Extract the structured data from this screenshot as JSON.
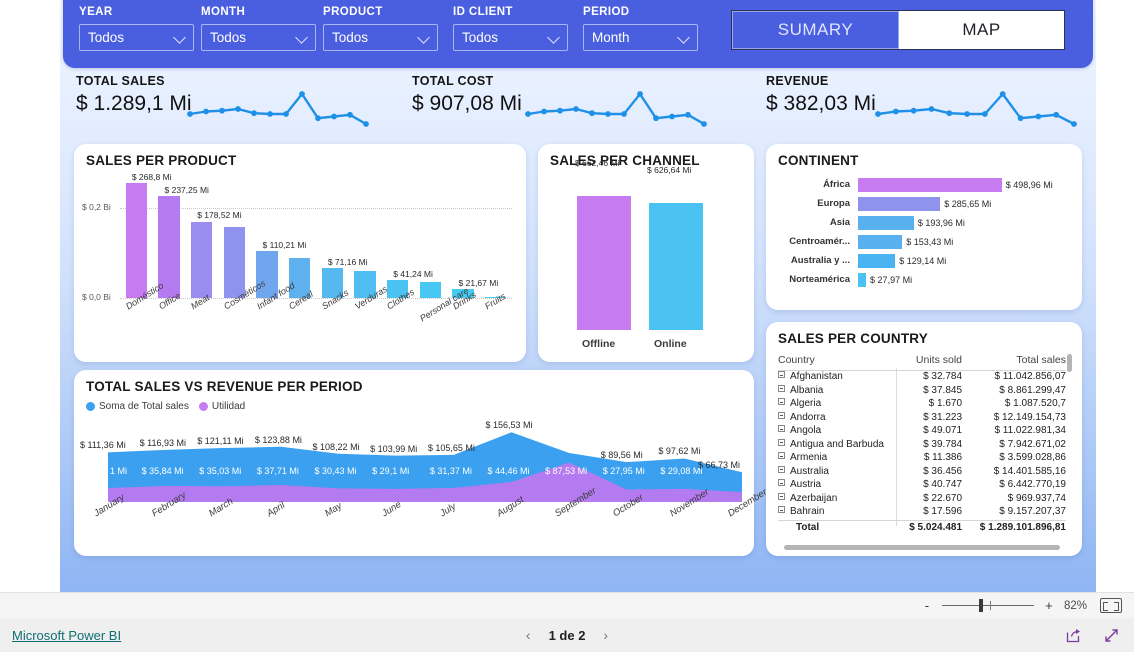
{
  "header": {
    "slicers": [
      {
        "label": "YEAR",
        "value": "Todos"
      },
      {
        "label": "MONTH",
        "value": "Todos"
      },
      {
        "label": "PRODUCT",
        "value": "Todos"
      },
      {
        "label": "ID CLIENT",
        "value": "Todos"
      },
      {
        "label": "PERIOD",
        "value": "Month"
      }
    ],
    "nav": {
      "active": "SUMARY",
      "inactive": "MAP"
    },
    "bg_color": "#4a5fe0"
  },
  "kpis": [
    {
      "title": "TOTAL SALES",
      "value": "$ 1.289,1 Mi"
    },
    {
      "title": "TOTAL COST",
      "value": "$ 907,08 Mi"
    },
    {
      "title": "REVENUE",
      "value": "$ 382,03 Mi"
    }
  ],
  "sparkline": {
    "color": "#1e90e8",
    "points": [
      34,
      40,
      42,
      46,
      36,
      34,
      34,
      82,
      24,
      28,
      32,
      10
    ]
  },
  "chart_data": [
    {
      "id": "sales_per_product",
      "type": "bar",
      "title": "SALES PER PRODUCT",
      "categories": [
        "Doméstico",
        "Office",
        "Meat",
        "Cosméticos",
        "Infant food",
        "Cereal",
        "Snacks",
        "Verduras",
        "Clothes",
        "Personal care",
        "Drinks",
        "Fruits"
      ],
      "values": [
        268.8,
        237.25,
        178.52,
        166.0,
        110.21,
        93.0,
        71.16,
        62.0,
        41.24,
        38.0,
        21.67,
        1.2
      ],
      "labels": [
        "$ 268,8 Mi",
        "$ 237,25 Mi",
        "$ 178,52 Mi",
        "",
        "$ 110,21 Mi",
        "",
        "$ 71,16 Mi",
        "",
        "$ 41,24 Mi",
        "",
        "$ 21,67 Mi",
        ""
      ],
      "colors": [
        "#c77bf0",
        "#b47bf0",
        "#9b8cf0",
        "#8f93ee",
        "#6fa6ee",
        "#5fb0ef",
        "#56b8f0",
        "#4fbdf1",
        "#4ac3f2",
        "#47c7f3",
        "#45cbf4",
        "#44cef5"
      ],
      "ylabel": "",
      "xlabel": "",
      "yticks": [
        "$ 0,2 Bi",
        "$ 0,0 Bi"
      ],
      "ylim": [
        0,
        280
      ],
      "grid": true
    },
    {
      "id": "sales_per_channel",
      "type": "bar",
      "title": "SALES PER CHANNEL",
      "categories": [
        "Offline",
        "Online"
      ],
      "values": [
        662.46,
        626.64
      ],
      "labels": [
        "$ 662,46 Mi",
        "$ 626,64 Mi"
      ],
      "colors": [
        "#c77bf0",
        "#4ac3f2"
      ],
      "ylim": [
        0,
        700
      ],
      "grid": false
    },
    {
      "id": "continent",
      "type": "bar",
      "title": "CONTINENT",
      "orientation": "horizontal",
      "categories": [
        "África",
        "Europa",
        "Asia",
        "Centroamér...",
        "Australia y ...",
        "Norteamérica"
      ],
      "values": [
        498.96,
        285.65,
        193.96,
        153.43,
        129.14,
        27.97
      ],
      "labels": [
        "$ 498,96 Mi",
        "$ 285,65 Mi",
        "$ 193,96 Mi",
        "$ 153,43 Mi",
        "$ 129,14 Mi",
        "$ 27,97 Mi"
      ],
      "colors": [
        "#c77bf0",
        "#8f93ee",
        "#58b0ef",
        "#58b0ef",
        "#4ab4f2",
        "#4ac3f2"
      ],
      "xlim": [
        0,
        500
      ],
      "grid": false
    },
    {
      "id": "total_sales_vs_revenue_per_period",
      "type": "area",
      "title": "TOTAL SALES VS REVENUE PER PERIOD",
      "categories": [
        "January",
        "February",
        "March",
        "April",
        "May",
        "June",
        "July",
        "August",
        "September",
        "October",
        "November",
        "December"
      ],
      "series": [
        {
          "name": "Soma de Total sales",
          "color": "#3aa0ef",
          "values": [
            111.36,
            116.93,
            121.11,
            123.88,
            108.22,
            103.99,
            105.65,
            156.53,
            110.0,
            89.56,
            97.62,
            66.73
          ],
          "labels": [
            "$ 111,36 Mi",
            "$ 116,93 Mi",
            "$ 121,11 Mi",
            "$ 123,88 Mi",
            "$ 108,22 Mi",
            "$ 103,99 Mi",
            "$ 105,65 Mi",
            "$ 156,53 Mi",
            "",
            "$ 89,56 Mi",
            "$ 97,62 Mi",
            "$ 66,73 Mi"
          ]
        },
        {
          "name": "Utilidad",
          "color": "#b47bf0",
          "values": [
            31.1,
            35.84,
            35.03,
            37.71,
            30.43,
            29.1,
            31.37,
            44.46,
            87.53,
            27.95,
            29.08,
            22.0
          ],
          "labels": [
            "1 Mi",
            "$ 35,84 Mi",
            "$ 35,03 Mi",
            "$ 37,71 Mi",
            "$ 30,43 Mi",
            "$ 29,1 Mi",
            "$ 31,37 Mi",
            "$ 44,46 Mi",
            "$ 87,53 Mi",
            "$ 27,95 Mi",
            "$ 29,08 Mi",
            ""
          ]
        }
      ],
      "legend_position": "top-left",
      "grid": false
    }
  ],
  "country_table": {
    "title": "SALES PER COUNTRY",
    "columns": [
      "Country",
      "Units sold",
      "Total sales"
    ],
    "rows": [
      {
        "country": "Afghanistan",
        "units": "$ 32.784",
        "sales": "$ 11.042.856,07"
      },
      {
        "country": "Albania",
        "units": "$ 37.845",
        "sales": "$ 8.861.299,47"
      },
      {
        "country": "Algeria",
        "units": "$ 1.670",
        "sales": "$ 1.087.520,7"
      },
      {
        "country": "Andorra",
        "units": "$ 31.223",
        "sales": "$ 12.149.154,73"
      },
      {
        "country": "Angola",
        "units": "$ 49.071",
        "sales": "$ 11.022.981,34"
      },
      {
        "country": "Antigua and Barbuda",
        "units": "$ 39.784",
        "sales": "$ 7.942.671,02"
      },
      {
        "country": "Armenia",
        "units": "$ 11.386",
        "sales": "$ 3.599.028,86"
      },
      {
        "country": "Australia",
        "units": "$ 36.456",
        "sales": "$ 14.401.585,16"
      },
      {
        "country": "Austria",
        "units": "$ 40.747",
        "sales": "$ 6.442.770,19"
      },
      {
        "country": "Azerbaijan",
        "units": "$ 22.670",
        "sales": "$ 969.937,74"
      },
      {
        "country": "Bahrain",
        "units": "$ 17.596",
        "sales": "$ 9.157.207,37"
      }
    ],
    "total": {
      "country": "Total",
      "units": "$ 5.024.481",
      "sales": "$ 1.289.101.896,81"
    }
  },
  "zoombar": {
    "minus": "-",
    "plus": "+",
    "level": "82%"
  },
  "statusbar": {
    "brand": "Microsoft Power BI",
    "page": "1 de 2"
  }
}
